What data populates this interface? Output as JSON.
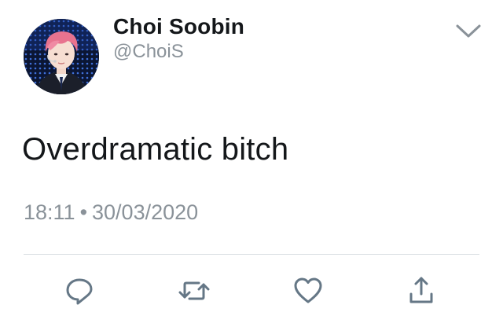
{
  "tweet": {
    "display_name": "Choi Soobin",
    "handle": "@ChoiS",
    "text": "Overdramatic bitch",
    "time": "18:11",
    "separator": "•",
    "date": "30/03/2020"
  },
  "icons": {
    "menu": "chevron-down-icon",
    "reply": "reply-icon",
    "retweet": "retweet-icon",
    "like": "heart-icon",
    "share": "share-icon"
  },
  "colors": {
    "text": "#14171a",
    "muted": "#8a9299",
    "icon": "#657786",
    "divider": "#d8dde1"
  }
}
